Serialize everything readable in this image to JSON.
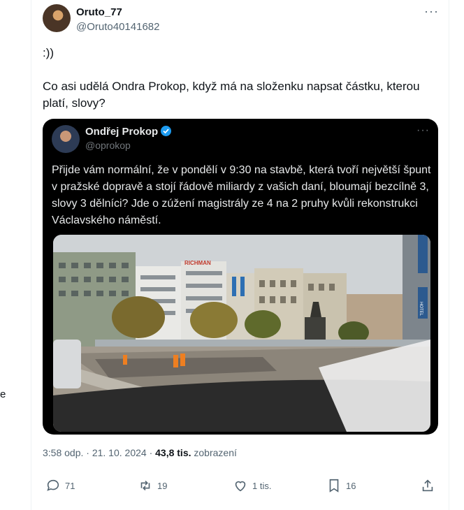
{
  "stray_text": "e",
  "tweet": {
    "display_name": "Oruto_77",
    "handle": "@Oruto40141682",
    "more_label": "···",
    "text_line1": ":))",
    "text_body": "Co asi udělá Ondra Prokop, když má na složenku napsat částku, kterou platí, slovy?",
    "timestamp": "3:58 odp. · 21. 10. 2024 ·",
    "views_count": "43,8 tis.",
    "views_label": "zobrazení"
  },
  "quoted": {
    "display_name": "Ondřej Prokop",
    "handle": "@oprokop",
    "more_label": "···",
    "text": "Přijde vám normální, že v pondělí v 9:30 na stavbě, která tvoří největší špunt v pražské dopravě a stojí řádově miliardy z vašich daní, bloumají bezcílně 3, slovy 3 dělníci? Jde o zúžení magistrály ze 4 na 2 pruhy kvůli rekonstrukci Václavského náměstí.",
    "photo": {
      "signs": [
        "RICHMAN",
        "HOTEL"
      ]
    }
  },
  "actions": {
    "reply": "71",
    "repost": "19",
    "like": "1 tis.",
    "bookmark": "16"
  }
}
